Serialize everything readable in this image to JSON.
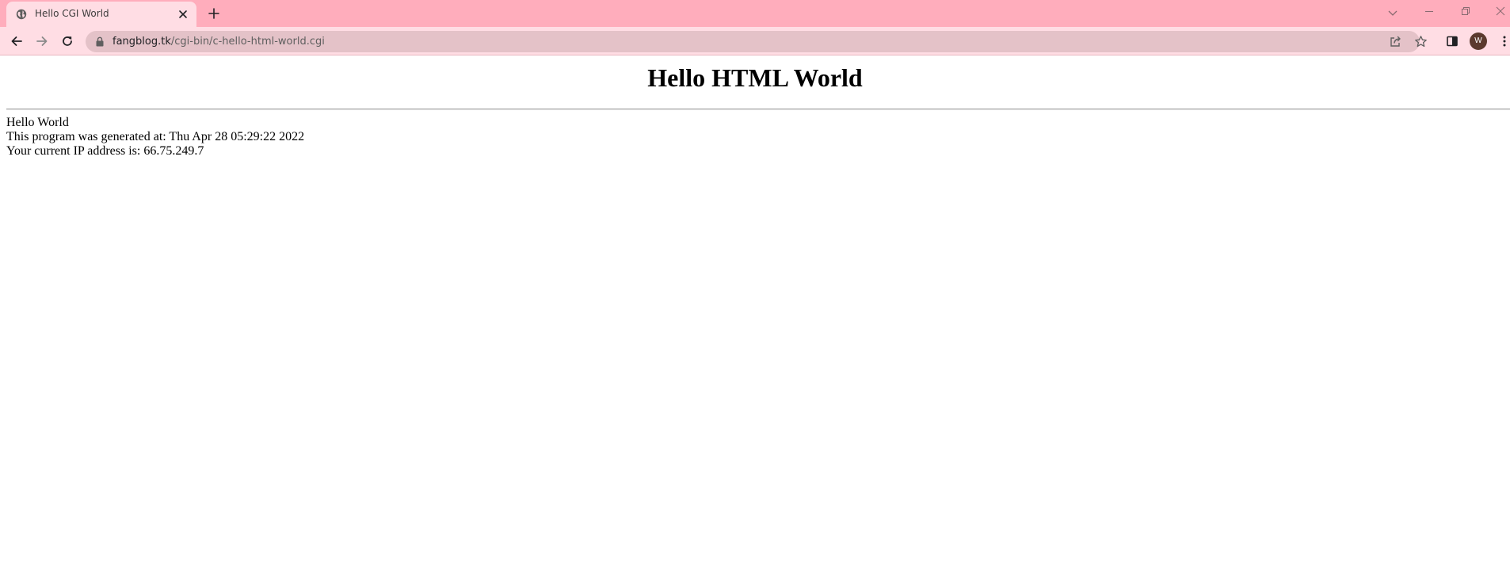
{
  "browser": {
    "tab": {
      "title": "Hello CGI World"
    },
    "address_bar": {
      "host": "fangblog.tk",
      "path": "/cgi-bin/c-hello-html-world.cgi"
    },
    "profile": {
      "initial": "W"
    },
    "icons": {
      "favicon": "globe-icon",
      "tab_close": "close-icon",
      "new_tab": "plus-icon",
      "tab_search": "chevron-down-icon",
      "minimize": "minimize-icon",
      "restore": "restore-icon",
      "close_window": "close-window-icon",
      "back": "back-arrow-icon",
      "forward": "forward-arrow-icon",
      "reload": "reload-icon",
      "lock": "lock-icon",
      "share": "share-icon",
      "bookmark": "star-icon",
      "side_panel": "side-panel-icon",
      "menu": "kebab-menu-icon"
    },
    "colors": {
      "tab_strip": "#ffadbc",
      "toolbar": "#ffdde4",
      "omnibox": "#e4c2c8"
    }
  },
  "page": {
    "heading": "Hello HTML World",
    "lines": [
      "Hello World",
      "This program was generated at: Thu Apr 28 05:29:22 2022",
      "Your current IP address is: 66.75.249.7"
    ]
  }
}
